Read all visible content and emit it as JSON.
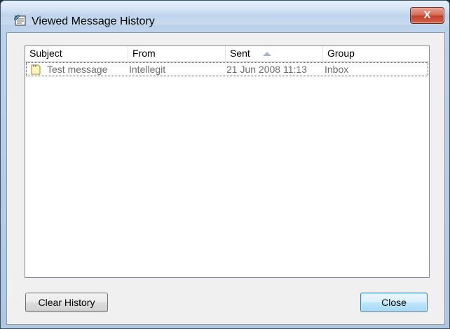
{
  "window": {
    "title": "Viewed Message History",
    "close_glyph": "X",
    "app_icon": "message-history-icon"
  },
  "list": {
    "columns": [
      {
        "label": "Subject"
      },
      {
        "label": "From"
      },
      {
        "label": "Sent",
        "sorted": "ascending"
      },
      {
        "label": "Group"
      }
    ],
    "rows": [
      {
        "icon": "message-note-icon",
        "subject": "Test message",
        "from": "Intellegit",
        "sent": "21 Jun 2008 11:13",
        "group": "Inbox",
        "focused": true
      }
    ]
  },
  "buttons": {
    "clear_history": "Clear History",
    "close": "Close"
  },
  "colors": {
    "title_close_red": "#c4412a",
    "default_button_blue": "#3c7fb1",
    "row_text_gray": "#6d6d6d"
  }
}
